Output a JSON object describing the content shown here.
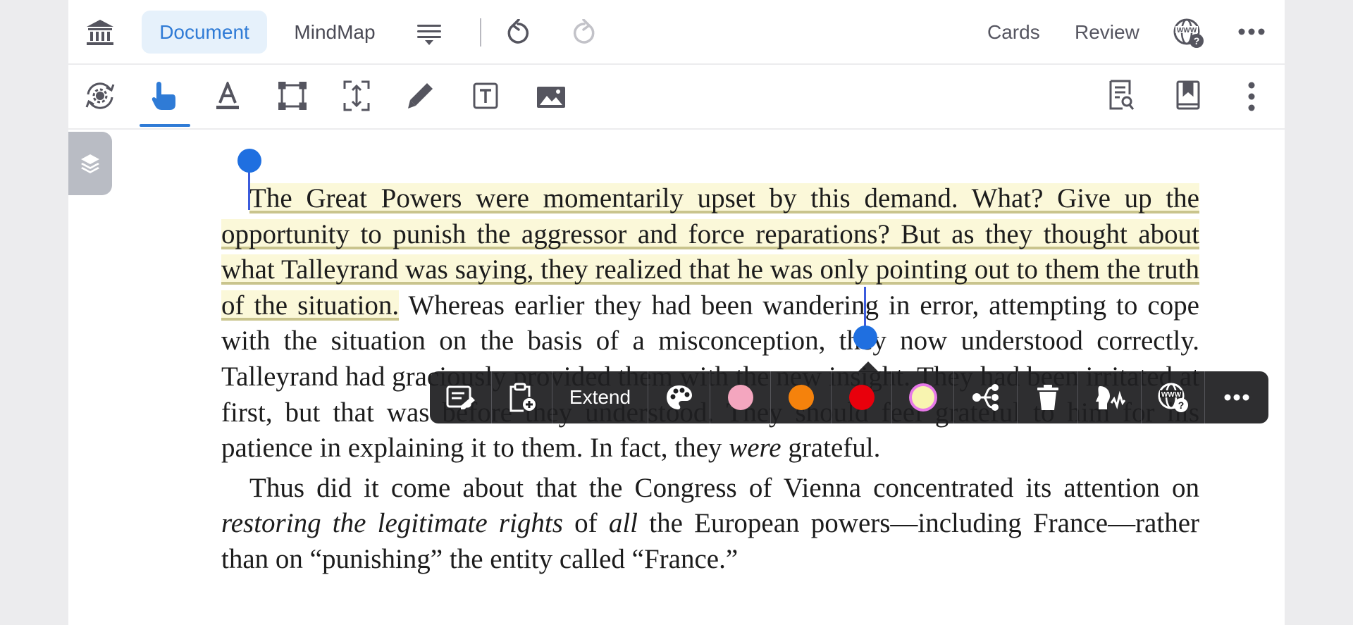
{
  "topbar": {
    "tabs": [
      {
        "label": "Document",
        "active": true
      },
      {
        "label": "MindMap",
        "active": false
      }
    ],
    "links": [
      "Cards",
      "Review"
    ],
    "icons": [
      "library-icon",
      "outline-menu-icon",
      "undo-icon",
      "redo-icon",
      "web-lookup-icon",
      "more-horizontal-icon"
    ]
  },
  "toolbar": {
    "tools": [
      "auto-sync-icon",
      "hand-select-icon",
      "text-highlight-icon",
      "rectangle-select-icon",
      "crop-expand-icon",
      "pencil-icon",
      "text-box-icon",
      "image-icon"
    ],
    "active_tool": "hand-select-icon",
    "right_tools": [
      "search-document-icon",
      "bookmark-icon",
      "more-vertical-icon"
    ]
  },
  "document": {
    "paragraph1": {
      "highlighted": "The Great Powers were momentarily upset by this demand. What? Give up the opportunity to punish the aggressor and force reparations? But as they thought about what Talleyrand was saying, they realized that he was only pointing out to them the truth of the situation.",
      "rest_before_italic": " Whereas earlier they had been wandering in error, attempting to cope with the situation on the basis of a misconception, they now understood correctly. Talleyrand had graciously provided them with the new insight. They had been irritated at first, but that was before they understood. They should feel grateful to him for his patience in explaining it to them. In fact, they ",
      "italic": "were",
      "end": " grateful."
    },
    "paragraph2": {
      "part1": "Thus did it come about that the Congress of Vienna concentrated its attention on ",
      "italic1": "restoring the legitimate rights",
      "part2": " of ",
      "italic2": "all",
      "part3": " the European powers—including France—rather than on “punishing” the entity called “France.”"
    }
  },
  "popup": {
    "extend_label": "Extend",
    "swatches": [
      "#f4a6bf",
      "#f5820c",
      "#e8000c",
      "#f8f4b0"
    ],
    "selected_swatch_ring": "#e779e8",
    "icons": [
      "edit-note-icon",
      "add-clipboard-icon",
      "palette-icon",
      "mindmap-branch-icon",
      "trash-icon",
      "voice-icon",
      "web-lookup-icon",
      "more-horizontal-icon"
    ]
  },
  "colors": {
    "accent": "#2f7bd6",
    "highlight_fill": "#fbf8d9",
    "selection_handle": "#1f6fe0"
  }
}
